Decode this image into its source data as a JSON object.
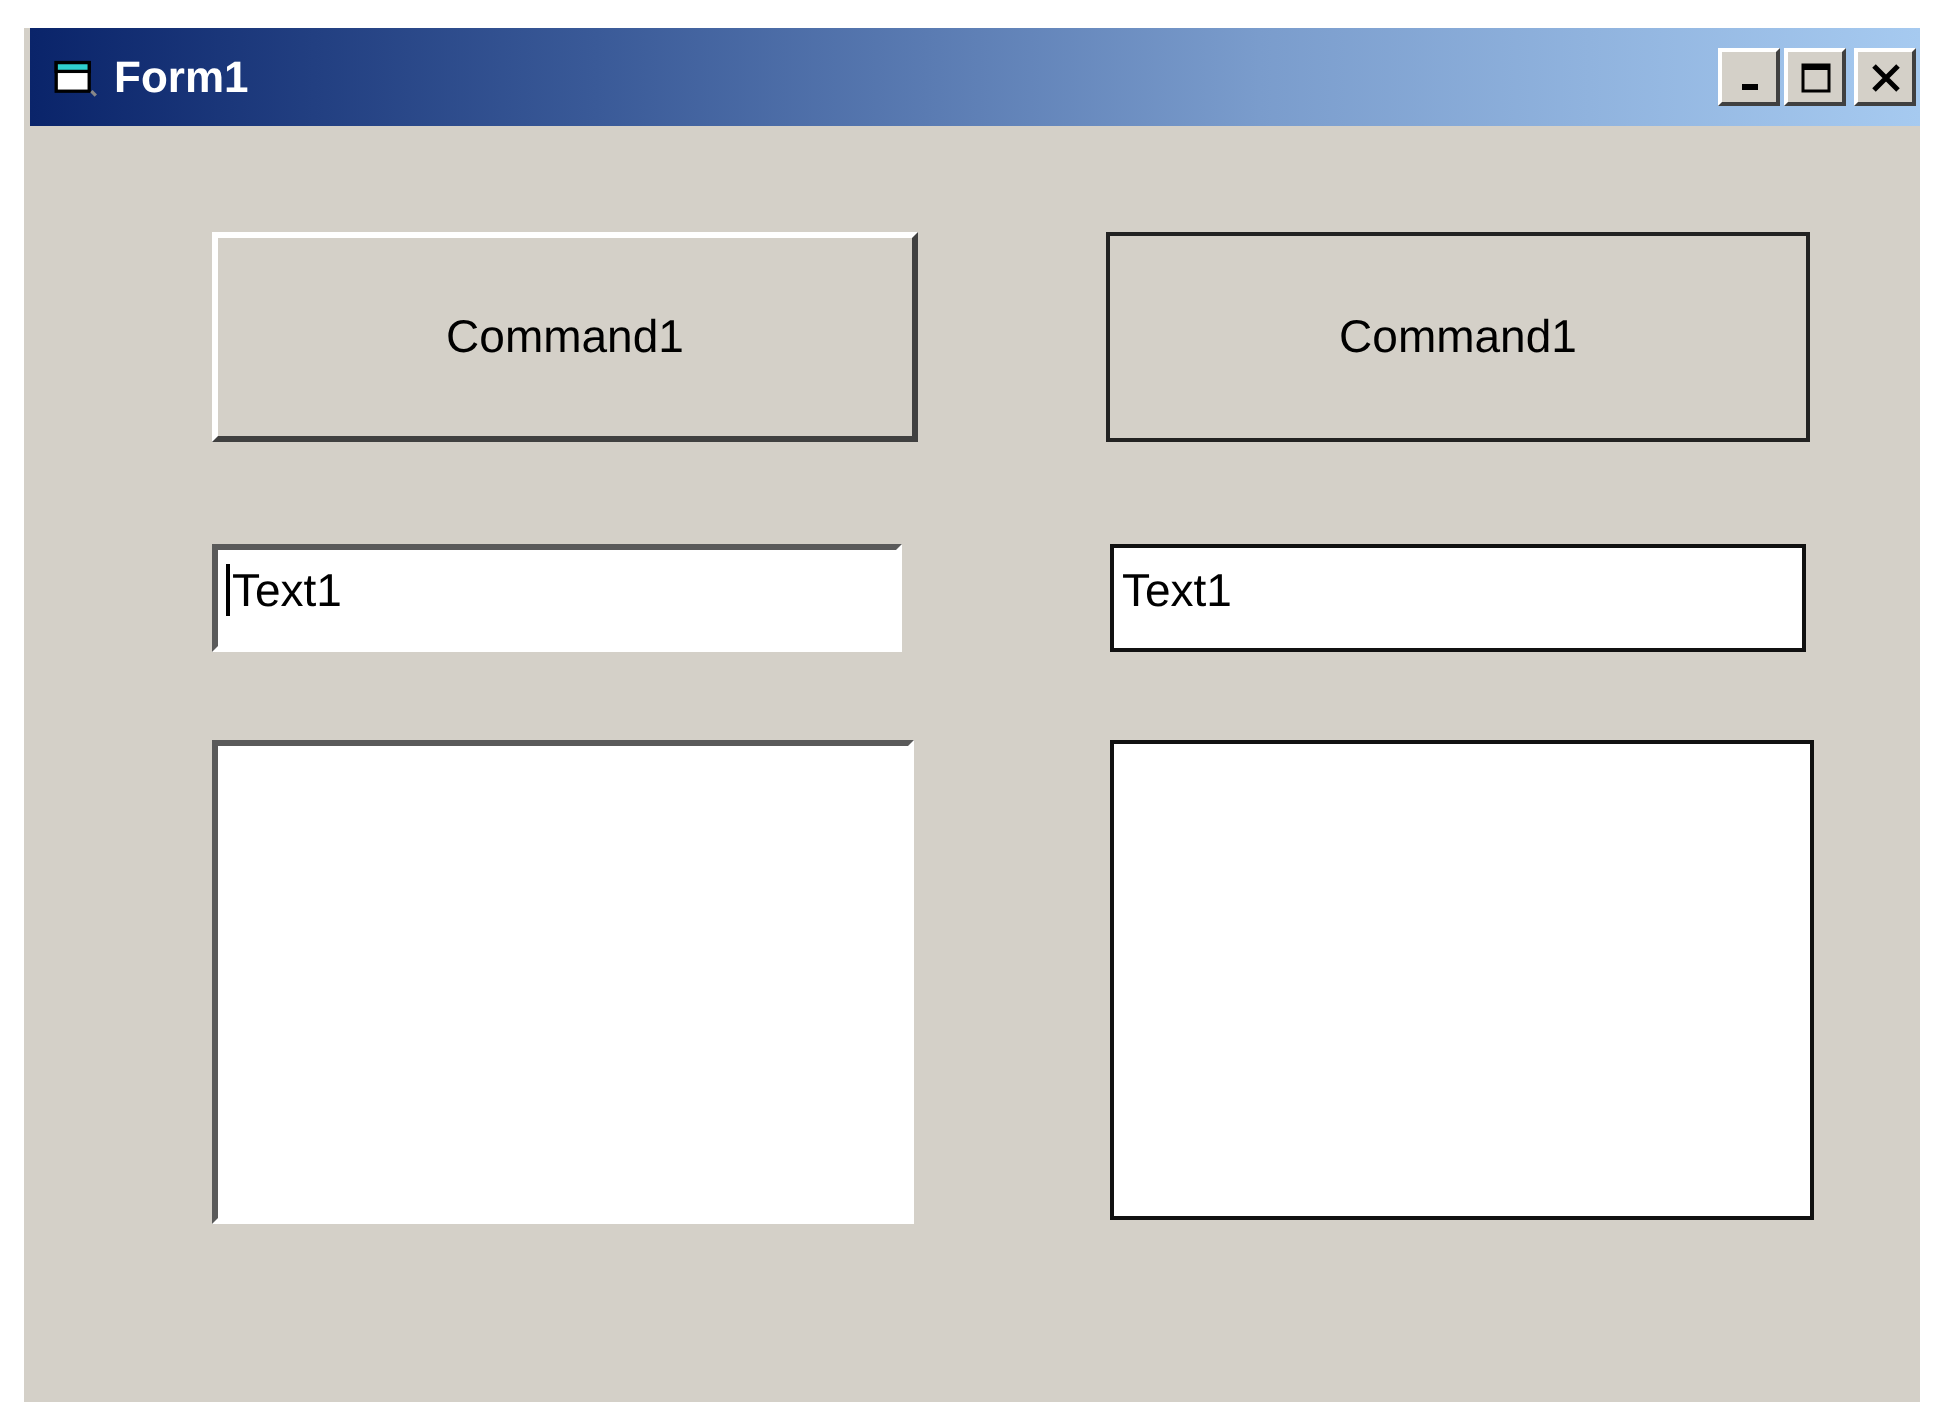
{
  "window": {
    "title": "Form1"
  },
  "columns": [
    {
      "kind": "raised",
      "controls": [
        {
          "kind": "button",
          "label": "Command1"
        },
        {
          "kind": "textbox",
          "value": "Text1",
          "focused": true
        },
        {
          "kind": "box"
        }
      ]
    },
    {
      "kind": "flat",
      "controls": [
        {
          "kind": "button",
          "label": "Command1"
        },
        {
          "kind": "textbox",
          "value": "Text1",
          "focused": false
        },
        {
          "kind": "box"
        }
      ]
    }
  ]
}
